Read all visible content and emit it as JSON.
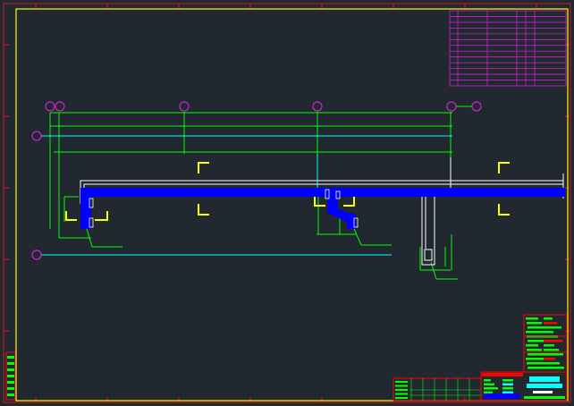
{
  "drawing": {
    "kind": "CAD duct layout drawing",
    "colors": {
      "background": "#212830",
      "outer_border": "#e0141e",
      "inner_frame": "#ffff00",
      "duct_fill": "#0000ff",
      "duct_outline": "#ffffff",
      "dimension_lines": "#00ff00",
      "reference_lines": "#00ffff",
      "grid_bubbles": "#d020d0",
      "section_marks": "#ffff00",
      "revision_table": "#d020d0",
      "title_block_red": "#ff0000",
      "title_block_green": "#00ff00",
      "title_block_cyan": "#00ffff"
    },
    "grid_markers": {
      "count_top": 6,
      "count_left": 2
    },
    "section_marks": {
      "pairs": 3
    },
    "duct_branches": 3,
    "revision_table": {
      "rows": 13,
      "columns": 6
    }
  }
}
